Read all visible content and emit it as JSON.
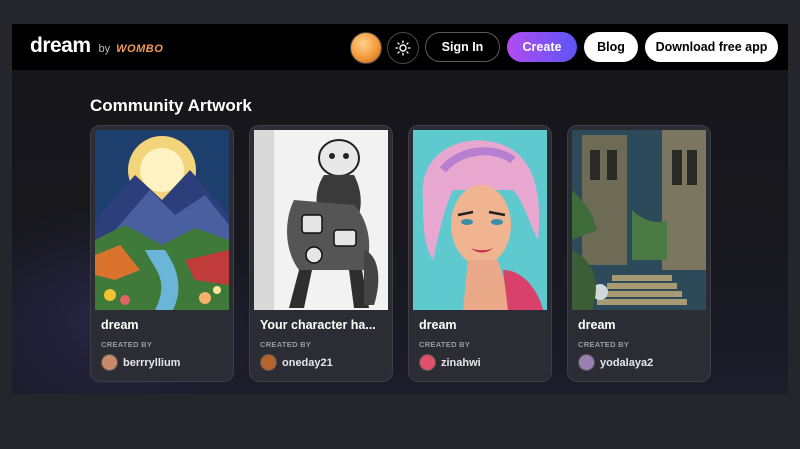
{
  "header": {
    "logo_text": "dream",
    "logo_by": "by",
    "logo_brand": "WOMBO",
    "signin_label": "Sign In",
    "create_label": "Create",
    "blog_label": "Blog",
    "download_label": "Download free app"
  },
  "community": {
    "title": "Community Artwork",
    "created_by_label": "CREATED BY",
    "cards": [
      {
        "title": "dream",
        "creator": "berrryllium",
        "avatar_color": "#c98a6a"
      },
      {
        "title": "Your character ha...",
        "creator": "oneday21",
        "avatar_color": "#b5652b"
      },
      {
        "title": "dream",
        "creator": "zinahwi",
        "avatar_color": "#e0506a"
      },
      {
        "title": "dream",
        "creator": "yodalaya2",
        "avatar_color": "#9a7fb0"
      }
    ]
  },
  "colors": {
    "create_gradient_start": "#b14df2",
    "create_gradient_end": "#5d55f5",
    "card_bg": "#2c2d34"
  }
}
